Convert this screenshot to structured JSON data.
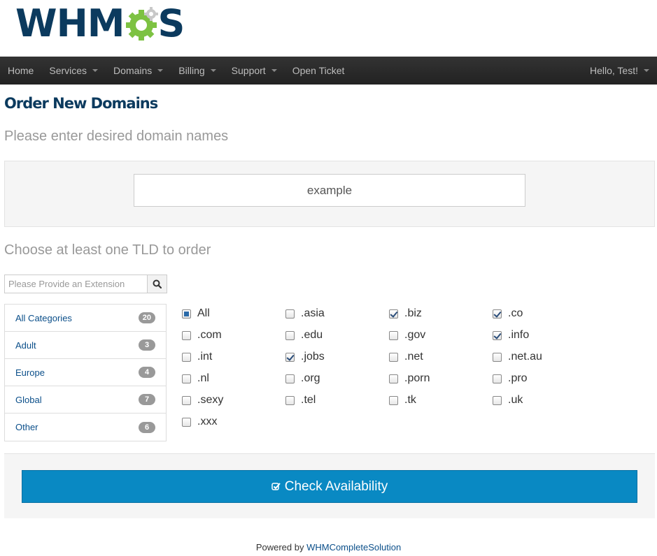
{
  "brand": {
    "logo_left": "WHM",
    "logo_right": "S",
    "colors": {
      "navy": "#0b3a5e",
      "green": "#7dc242"
    }
  },
  "nav": {
    "items": [
      {
        "label": "Home",
        "dropdown": false
      },
      {
        "label": "Services",
        "dropdown": true
      },
      {
        "label": "Domains",
        "dropdown": true
      },
      {
        "label": "Billing",
        "dropdown": true
      },
      {
        "label": "Support",
        "dropdown": true
      },
      {
        "label": "Open Ticket",
        "dropdown": false
      }
    ],
    "user_greeting": "Hello, Test!"
  },
  "page": {
    "title": "Order New Domains",
    "domain_prompt": "Please enter desired domain names",
    "domain_value": "example",
    "tld_prompt": "Choose at least one TLD to order"
  },
  "search": {
    "placeholder": "Please Provide an Extension",
    "icon": "search-icon"
  },
  "categories": [
    {
      "label": "All Categories",
      "count": "20"
    },
    {
      "label": "Adult",
      "count": "3"
    },
    {
      "label": "Europe",
      "count": "4"
    },
    {
      "label": "Global",
      "count": "7"
    },
    {
      "label": "Other",
      "count": "6"
    }
  ],
  "tlds": [
    {
      "label": "All",
      "state": "partial"
    },
    {
      "label": ".asia",
      "state": "unchecked"
    },
    {
      "label": ".biz",
      "state": "checked"
    },
    {
      "label": ".co",
      "state": "checked"
    },
    {
      "label": ".com",
      "state": "unchecked"
    },
    {
      "label": ".edu",
      "state": "unchecked"
    },
    {
      "label": ".gov",
      "state": "unchecked"
    },
    {
      "label": ".info",
      "state": "checked"
    },
    {
      "label": ".int",
      "state": "unchecked"
    },
    {
      "label": ".jobs",
      "state": "checked"
    },
    {
      "label": ".net",
      "state": "unchecked"
    },
    {
      "label": ".net.au",
      "state": "unchecked"
    },
    {
      "label": ".nl",
      "state": "unchecked"
    },
    {
      "label": ".org",
      "state": "unchecked"
    },
    {
      "label": ".porn",
      "state": "unchecked"
    },
    {
      "label": ".pro",
      "state": "unchecked"
    },
    {
      "label": ".sexy",
      "state": "unchecked"
    },
    {
      "label": ".tel",
      "state": "unchecked"
    },
    {
      "label": ".tk",
      "state": "unchecked"
    },
    {
      "label": ".uk",
      "state": "unchecked"
    },
    {
      "label": ".xxx",
      "state": "unchecked"
    }
  ],
  "action": {
    "check_label": "Check Availability",
    "button_color": "#0989c3"
  },
  "footer": {
    "prefix": "Powered by ",
    "link": "WHMCompleteSolution"
  }
}
